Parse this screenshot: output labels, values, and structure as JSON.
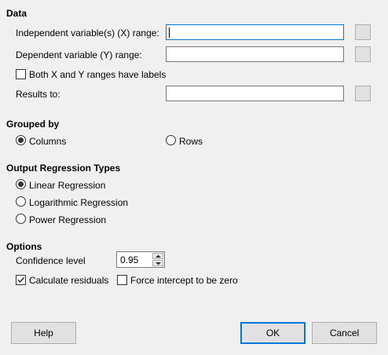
{
  "data_section": {
    "title": "Data",
    "independent_label": "Independent variable(s) (X) range:",
    "independent_value": "",
    "dependent_label": "Dependent variable (Y) range:",
    "dependent_value": "",
    "labels_checkbox": "Both X and Y ranges have labels",
    "labels_checked": false,
    "results_label": "Results to:",
    "results_value": ""
  },
  "grouped_by": {
    "title": "Grouped by",
    "options": [
      {
        "label": "Columns",
        "selected": true
      },
      {
        "label": "Rows",
        "selected": false
      }
    ]
  },
  "regression_types": {
    "title": "Output Regression Types",
    "options": [
      {
        "label": "Linear Regression",
        "selected": true
      },
      {
        "label": "Logarithmic Regression",
        "selected": false
      },
      {
        "label": "Power Regression",
        "selected": false
      }
    ]
  },
  "options_section": {
    "title": "Options",
    "confidence_label": "Confidence level",
    "confidence_value": "0.95",
    "residuals_label": "Calculate residuals",
    "residuals_checked": true,
    "intercept_label": "Force intercept to be zero",
    "intercept_checked": false
  },
  "buttons": {
    "help": "Help",
    "ok": "OK",
    "cancel": "Cancel"
  }
}
